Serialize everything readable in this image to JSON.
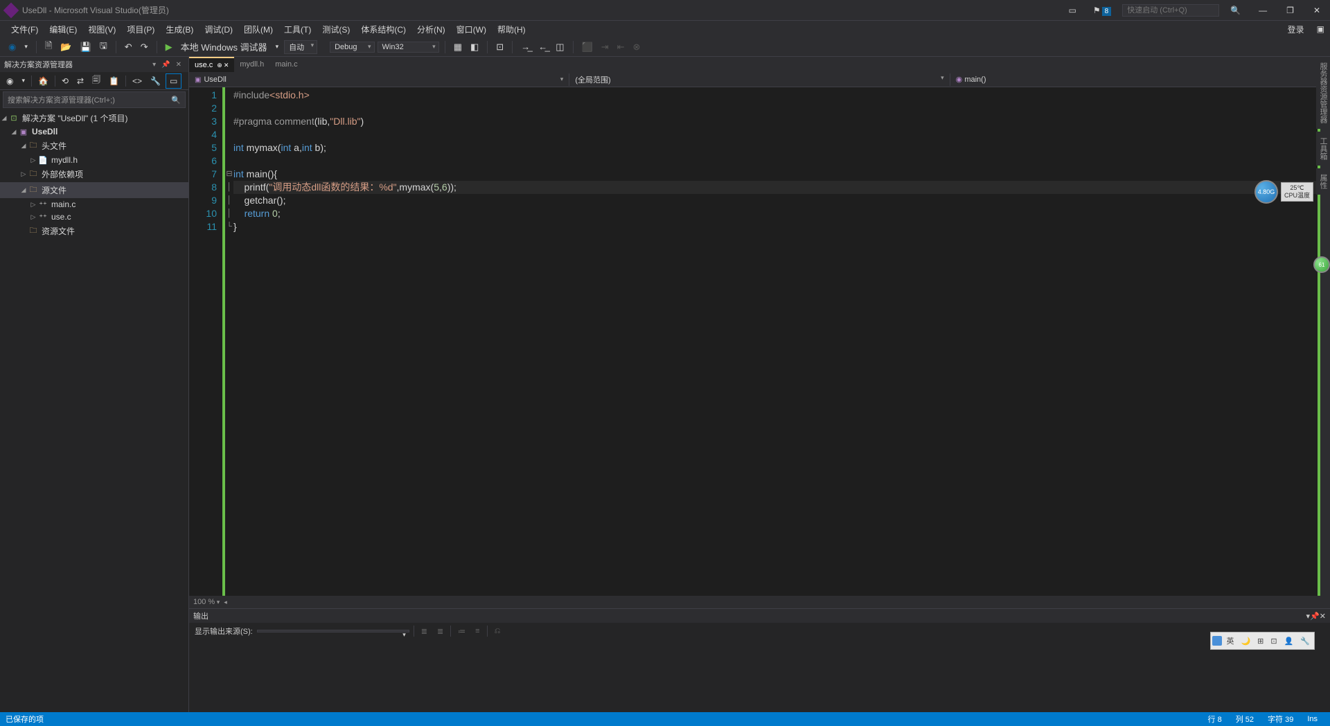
{
  "titlebar": {
    "title": "UseDll - Microsoft Visual Studio(管理员)",
    "notif_count": "8",
    "quicklaunch_placeholder": "快速启动 (Ctrl+Q)"
  },
  "menubar": {
    "items": [
      "文件(F)",
      "编辑(E)",
      "视图(V)",
      "项目(P)",
      "生成(B)",
      "调试(D)",
      "团队(M)",
      "工具(T)",
      "测试(S)",
      "体系结构(C)",
      "分析(N)",
      "窗口(W)",
      "帮助(H)"
    ],
    "signin": "登录"
  },
  "toolbar": {
    "debug_target": "本地 Windows 调试器",
    "config_auto": "自动",
    "config_debug": "Debug",
    "config_platform": "Win32"
  },
  "solution": {
    "panel_title": "解决方案资源管理器",
    "search_placeholder": "搜索解决方案资源管理器(Ctrl+;)",
    "root": "解决方案 \"UseDll\" (1 个项目)",
    "project": "UseDll",
    "folders": {
      "headers": "头文件",
      "external": "外部依赖项",
      "sources": "源文件",
      "resources": "资源文件"
    },
    "files": {
      "mydll_h": "mydll.h",
      "main_c": "main.c",
      "use_c": "use.c"
    }
  },
  "tabs": {
    "use_c": "use.c",
    "mydll_h": "mydll.h",
    "main_c": "main.c"
  },
  "navbar": {
    "project": "UseDll",
    "scope": "(全局范围)",
    "func": "main()"
  },
  "code": {
    "lines": [
      "#include<stdio.h>",
      "",
      "#pragma comment(lib,\"Dll.lib\")",
      "",
      "int mymax(int a,int b);",
      "",
      "int main(){",
      "    printf(\"调用动态dll函数的结果：%d\",mymax(5,6));",
      "    getchar();",
      "    return 0;",
      "}"
    ]
  },
  "zoom": "100 %",
  "output": {
    "title": "输出",
    "source_label": "显示输出来源(S):"
  },
  "statusbar": {
    "saved": "已保存的项",
    "line": "行 8",
    "col": "列 52",
    "char": "字符 39",
    "ins": "Ins"
  },
  "right_dock": [
    "服务器资源管理器",
    "工具箱",
    "属性"
  ],
  "widgets": {
    "cpu_value": "4.80G",
    "cpu_temp": "25℃",
    "cpu_label": "CPU温度",
    "green_value": "61"
  },
  "ime": {
    "lang": "英"
  }
}
